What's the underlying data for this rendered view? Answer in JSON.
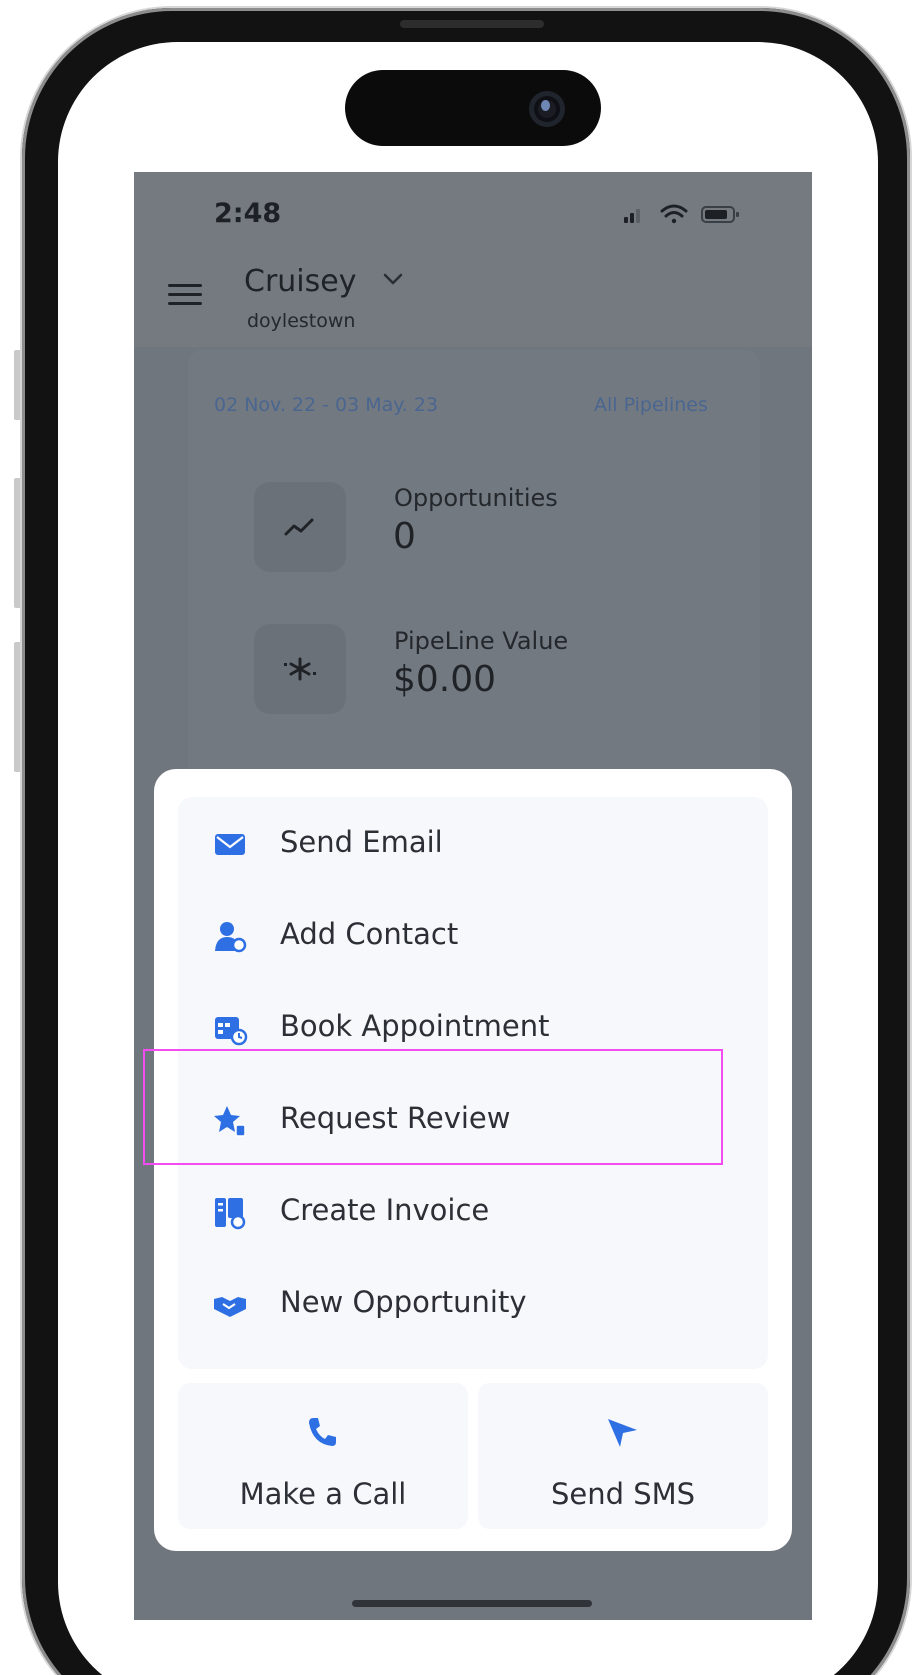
{
  "status_bar": {
    "time": "2:48"
  },
  "header": {
    "account_name": "Cruisey",
    "account_location": "doylestown"
  },
  "dashboard": {
    "date_range": "02 Nov. 22 - 03 May. 23",
    "pipelines_link": "All Pipelines",
    "stats": [
      {
        "label": "Opportunities",
        "value": "0",
        "icon": "trend-line-icon"
      },
      {
        "label": "PipeLine Value",
        "value": "$0.00",
        "icon": "asterisk-value-icon"
      }
    ]
  },
  "action_sheet": {
    "items": [
      {
        "label": "Send Email",
        "icon": "email-icon"
      },
      {
        "label": "Add Contact",
        "icon": "add-contact-icon"
      },
      {
        "label": "Book Appointment",
        "icon": "calendar-icon"
      },
      {
        "label": "Request Review",
        "icon": "review-star-icon"
      },
      {
        "label": "Create Invoice",
        "icon": "invoice-icon"
      },
      {
        "label": "New Opportunity",
        "icon": "handshake-icon"
      }
    ],
    "highlighted_item": "Request Review",
    "highlight_color": "#f24cf2",
    "bottom_actions": [
      {
        "label": "Make a Call",
        "icon": "phone-icon"
      },
      {
        "label": "Send SMS",
        "icon": "send-icon"
      }
    ]
  },
  "colors": {
    "accent": "#2f6fe4",
    "overlay": "#70767d",
    "sheet_background": "#ffffff",
    "item_background": "#f6f8fb"
  }
}
